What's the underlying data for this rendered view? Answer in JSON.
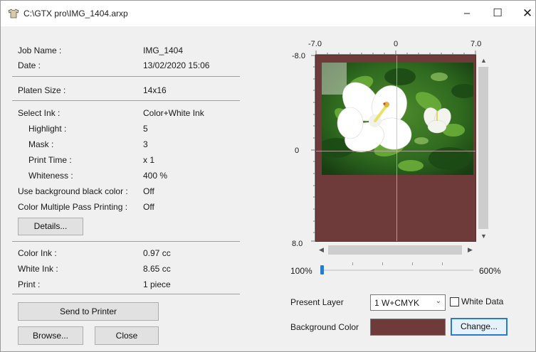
{
  "window": {
    "title": "C:\\GTX pro\\IMG_1404.arxp",
    "minimize_glyph": "–",
    "maximize_glyph": "☐",
    "close_glyph": "✕"
  },
  "info": {
    "job_name": {
      "label": "Job Name :",
      "value": "IMG_1404"
    },
    "date": {
      "label": "Date :",
      "value": "13/02/2020 15:06"
    },
    "platen_size": {
      "label": "Platen Size :",
      "value": "14x16"
    },
    "select_ink": {
      "label": "Select Ink :",
      "value": "Color+White Ink"
    },
    "highlight": {
      "label": "Highlight :",
      "value": "5"
    },
    "mask": {
      "label": "Mask :",
      "value": "3"
    },
    "print_time": {
      "label": "Print Time :",
      "value": "x 1"
    },
    "whiteness": {
      "label": "Whiteness :",
      "value": "400 %"
    },
    "use_bg_black": {
      "label": "Use background black color :",
      "value": "Off"
    },
    "color_multi_pass": {
      "label": "Color Multiple Pass Printing :",
      "value": "Off"
    },
    "color_ink": {
      "label": "Color Ink :",
      "value": "0.97 cc"
    },
    "white_ink": {
      "label": "White Ink :",
      "value": "8.65 cc"
    },
    "print": {
      "label": "Print :",
      "value": "1 piece"
    }
  },
  "buttons": {
    "details": "Details...",
    "send_to_printer": "Send to Printer",
    "browse": "Browse...",
    "close": "Close",
    "change": "Change..."
  },
  "preview": {
    "ruler_top": [
      "-7.0",
      "0",
      "7.0"
    ],
    "ruler_left": [
      "-8.0",
      "0",
      "8.0"
    ],
    "zoom_min_label": "100%",
    "zoom_max_label": "600%",
    "zoom_value_percent": 0,
    "background_color": "#6f3a3a"
  },
  "layer": {
    "label": "Present Layer",
    "selected": "1  W+CMYK",
    "white_data_label": "White Data",
    "white_data_checked": false
  },
  "background": {
    "label": "Background Color",
    "color": "#6f3a3a"
  }
}
